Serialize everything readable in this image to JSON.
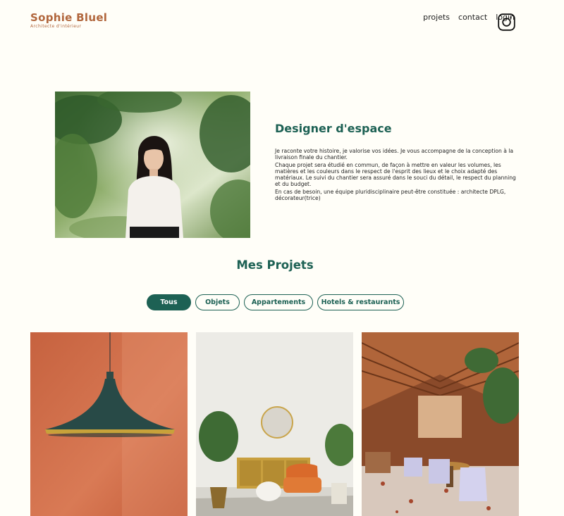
{
  "header": {
    "logo_title": "Sophie Bluel",
    "logo_subtitle": "Architecte d'intérieur",
    "nav": [
      {
        "label": "projets"
      },
      {
        "label": "contact"
      },
      {
        "label": "login"
      }
    ],
    "instagram_icon": "instagram-icon"
  },
  "introduction": {
    "title": "Designer d'espace",
    "paragraphs": [
      "Je raconte votre histoire, je valorise vos idées. Je vous accompagne de la conception à la livraison finale du chantier.",
      "Chaque projet sera étudié en commun, de façon à mettre en valeur les volumes, les matières et les couleurs dans le respect de l'esprit des lieux et le choix adapté des matériaux. Le suivi du chantier sera assuré dans le souci du détail, le respect du planning et du budget.",
      "En cas de besoin, une équipe pluridisciplinaire peut-être constituée : architecte DPLG, décorateur(trice)"
    ]
  },
  "portfolio": {
    "title": "Mes Projets",
    "filters": [
      {
        "label": "Tous",
        "active": true
      },
      {
        "label": "Objets",
        "active": false
      },
      {
        "label": "Appartements",
        "active": false
      },
      {
        "label": "Hotels & restaurants",
        "active": false
      }
    ]
  },
  "colors": {
    "brand_green": "#1d6154",
    "logo_brown": "#b1663c",
    "background": "#fffef8"
  }
}
